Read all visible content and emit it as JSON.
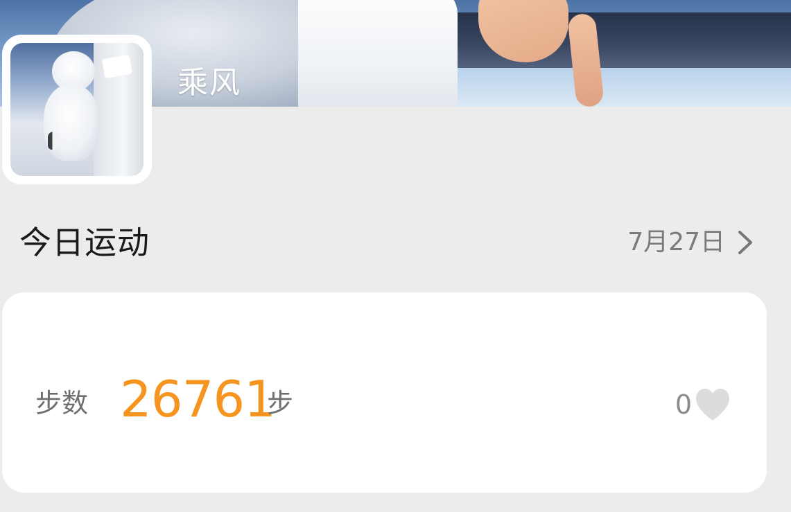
{
  "profile": {
    "username": "乘风"
  },
  "today": {
    "section_title": "今日运动",
    "date": "7月27日",
    "steps_label": "步数",
    "steps_value": "26761",
    "steps_unit": "步",
    "like_count": "0"
  },
  "colors": {
    "page_background": "#ececec",
    "accent_steps": "#f5951f",
    "heart": "#dcdcdc"
  },
  "icons": {
    "date_link": "chevron-right-icon",
    "like": "heart-icon"
  }
}
